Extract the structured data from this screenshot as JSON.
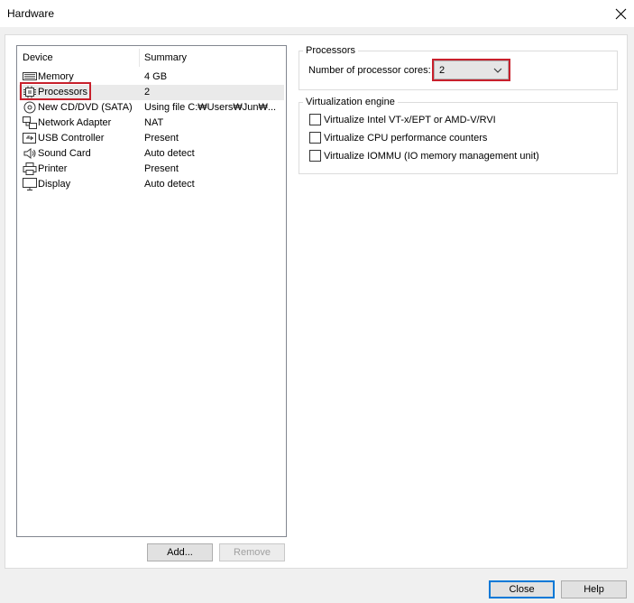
{
  "window": {
    "title": "Hardware"
  },
  "device_list": {
    "headers": {
      "device": "Device",
      "summary": "Summary"
    },
    "items": [
      {
        "name": "Memory",
        "summary": "4 GB",
        "icon": "memory-icon"
      },
      {
        "name": "Processors",
        "summary": "2",
        "icon": "processor-icon",
        "selected": true
      },
      {
        "name": "New CD/DVD (SATA)",
        "summary": "Using file C:₩Users₩Jun₩...",
        "icon": "cd-dvd-icon"
      },
      {
        "name": "Network Adapter",
        "summary": "NAT",
        "icon": "network-adapter-icon"
      },
      {
        "name": "USB Controller",
        "summary": "Present",
        "icon": "usb-icon"
      },
      {
        "name": "Sound Card",
        "summary": "Auto detect",
        "icon": "speaker-icon"
      },
      {
        "name": "Printer",
        "summary": "Present",
        "icon": "printer-icon"
      },
      {
        "name": "Display",
        "summary": "Auto detect",
        "icon": "display-icon"
      }
    ]
  },
  "buttons": {
    "add": "Add...",
    "remove": "Remove",
    "close": "Close",
    "help": "Help"
  },
  "processors": {
    "group_label": "Processors",
    "cores_label": "Number of processor cores:",
    "cores_value": "2"
  },
  "virtualization": {
    "group_label": "Virtualization engine",
    "options": [
      {
        "label": "Virtualize Intel VT-x/EPT or AMD-V/RVI",
        "checked": false
      },
      {
        "label": "Virtualize CPU performance counters",
        "checked": false
      },
      {
        "label": "Virtualize IOMMU (IO memory management unit)",
        "checked": false
      }
    ]
  },
  "colors": {
    "highlight": "#c8202c",
    "selected_row": "#eaeaea",
    "primary_border": "#0078d7"
  }
}
